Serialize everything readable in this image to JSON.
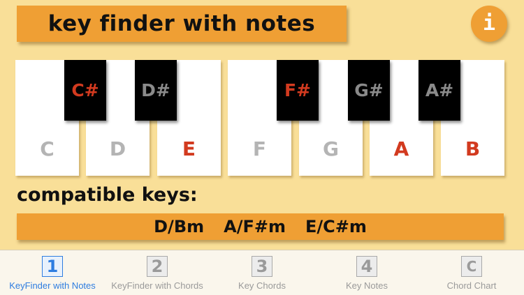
{
  "header": {
    "title": "key finder with notes",
    "info_glyph": "i"
  },
  "keyboard": {
    "white_keys": [
      {
        "note": "C",
        "color": "#b4b4b4"
      },
      {
        "note": "D",
        "color": "#b4b4b4"
      },
      {
        "note": "E",
        "color": "#d23a1f"
      },
      {
        "note": "F",
        "color": "#b4b4b4"
      },
      {
        "note": "G",
        "color": "#b4b4b4"
      },
      {
        "note": "A",
        "color": "#d23a1f"
      },
      {
        "note": "B",
        "color": "#d23a1f"
      }
    ],
    "black_keys": [
      {
        "note": "C#",
        "color": "#d23a1f"
      },
      {
        "note": "D#",
        "color": "#8a8a8a"
      },
      {
        "note": "F#",
        "color": "#d23a1f"
      },
      {
        "note": "G#",
        "color": "#8a8a8a"
      },
      {
        "note": "A#",
        "color": "#8a8a8a"
      }
    ]
  },
  "compatible": {
    "label": "compatible keys:",
    "keys": [
      "D/Bm",
      "A/F#m",
      "E/C#m"
    ]
  },
  "tabbar": {
    "tabs": [
      {
        "icon": "1",
        "label": "KeyFinder with Notes",
        "active": true
      },
      {
        "icon": "2",
        "label": "KeyFinder with Chords",
        "active": false
      },
      {
        "icon": "3",
        "label": "Key Chords",
        "active": false
      },
      {
        "icon": "4",
        "label": "Key Notes",
        "active": false
      },
      {
        "icon": "C",
        "label": "Chord Chart",
        "active": false
      }
    ]
  },
  "colors": {
    "background": "#f9df98",
    "accent_orange": "#ef9f34",
    "highlight_note": "#d23a1f",
    "active_tab": "#2e7de0"
  }
}
